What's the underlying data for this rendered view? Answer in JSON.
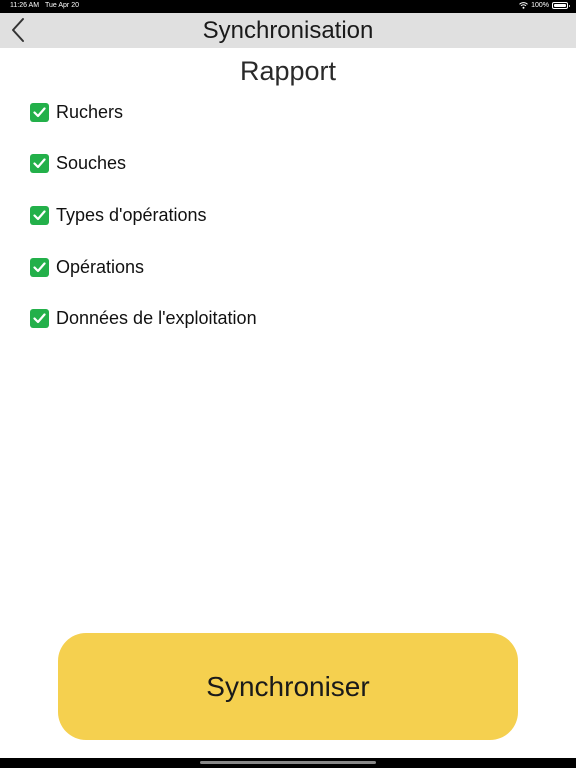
{
  "status_bar": {
    "time": "11:26 AM",
    "date": "Tue Apr 20",
    "battery_percent": "100%",
    "battery_level": 1.0,
    "wifi_icon": "wifi-icon",
    "battery_icon": "battery-icon"
  },
  "nav": {
    "title": "Synchronisation",
    "back_icon": "chevron-left-icon"
  },
  "report": {
    "title": "Rapport",
    "items": [
      {
        "label": "Ruchers",
        "status": "done"
      },
      {
        "label": "Souches",
        "status": "done"
      },
      {
        "label": "Types d'opérations",
        "status": "done"
      },
      {
        "label": "Opérations",
        "status": "done"
      },
      {
        "label": "Données de l'exploitation",
        "status": "done"
      }
    ],
    "check_color": "#23b04a"
  },
  "sync_button": {
    "label": "Synchroniser",
    "color": "#f5d04f"
  }
}
